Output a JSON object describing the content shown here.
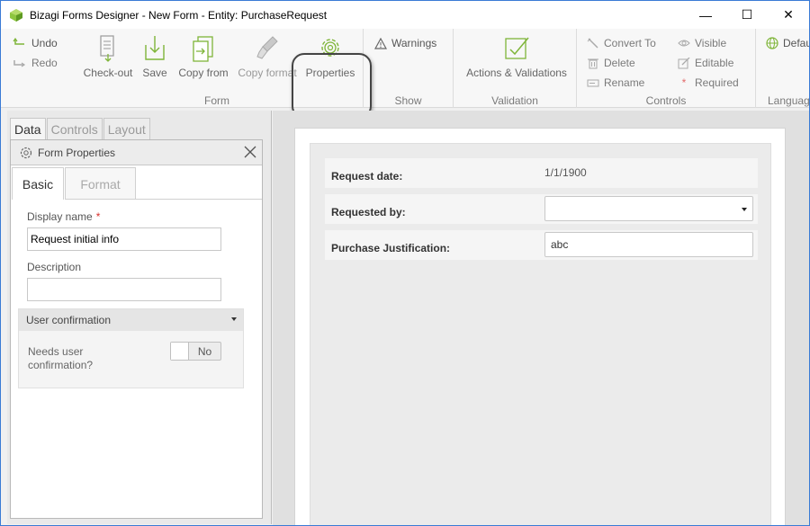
{
  "window": {
    "title": "Bizagi Forms Designer  - New Form - Entity:  PurchaseRequest",
    "controls": {
      "minimize": "—",
      "maximize": "☐",
      "close": "✕"
    }
  },
  "ribbon": {
    "history": {
      "undo": "Undo",
      "redo": "Redo"
    },
    "form_group": {
      "label": "Form",
      "checkout": "Check-out",
      "save": "Save",
      "copy_from": "Copy from",
      "copy_format": "Copy format",
      "properties": "Properties"
    },
    "show_group": {
      "label": "Show",
      "warnings": "Warnings"
    },
    "validation_group": {
      "label": "Validation",
      "actions": "Actions & Validations"
    },
    "controls_group": {
      "label": "Controls",
      "convert_to": "Convert To",
      "delete": "Delete",
      "rename": "Rename",
      "visible": "Visible",
      "editable": "Editable",
      "required": "Required"
    },
    "language_group": {
      "label": "Languag",
      "default": "Defau"
    }
  },
  "left_panel": {
    "tabs": [
      "Data",
      "Controls",
      "Layout"
    ],
    "properties": {
      "title": "Form Properties",
      "tabs": {
        "basic": "Basic",
        "format": "Format"
      },
      "display_name_label": "Display name",
      "required_mark": "*",
      "display_name_value": "Request initial info",
      "description_label": "Description",
      "description_value": "",
      "section_title": "User confirmation",
      "needs_confirmation_label": "Needs user confirmation?",
      "toggle_value": "No"
    }
  },
  "form": {
    "rows": [
      {
        "label": "Request date:",
        "value": "1/1/1900"
      },
      {
        "label": "Requested by:",
        "value": ""
      },
      {
        "label": "Purchase Justification:",
        "value": "abc"
      }
    ]
  },
  "colors": {
    "accent_green": "#7fb539",
    "icon_gray": "#8a8a8a",
    "required_red": "#d9302c",
    "window_border": "#3a7bd5"
  }
}
